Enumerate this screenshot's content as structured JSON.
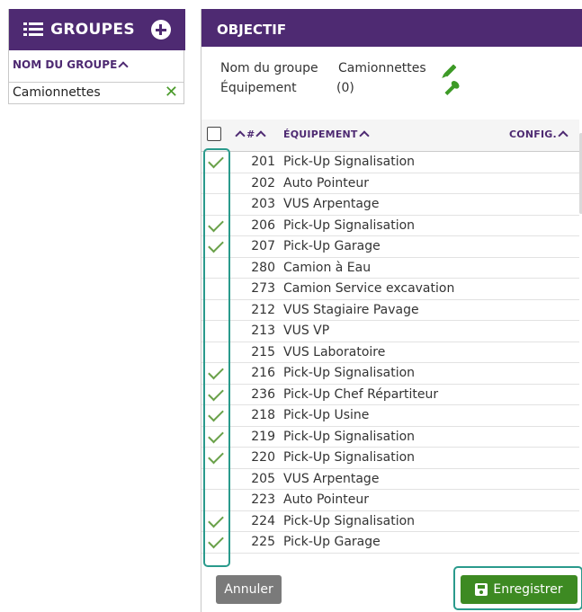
{
  "groups_panel": {
    "title": "GROUPES",
    "column_header": "NOM DU GROUPE",
    "rows": [
      {
        "name": "Camionnettes"
      }
    ]
  },
  "objective_panel": {
    "title": "OBJECTIF",
    "group_name_label": "Nom du groupe",
    "group_name_value": "Camionnettes",
    "equipment_label": "Équipement",
    "equipment_count": "(0)"
  },
  "table": {
    "col_num": "#",
    "col_equipment": "ÉQUIPEMENT",
    "col_config": "CONFIG.",
    "rows": [
      {
        "checked": true,
        "num": "201",
        "name": "Pick-Up Signalisation"
      },
      {
        "checked": false,
        "num": "202",
        "name": "Auto Pointeur"
      },
      {
        "checked": false,
        "num": "203",
        "name": "VUS Arpentage"
      },
      {
        "checked": true,
        "num": "206",
        "name": "Pick-Up Signalisation"
      },
      {
        "checked": true,
        "num": "207",
        "name": "Pick-Up Garage"
      },
      {
        "checked": false,
        "num": "280",
        "name": "Camion à Eau"
      },
      {
        "checked": false,
        "num": "273",
        "name": "Camion Service excavation"
      },
      {
        "checked": false,
        "num": "212",
        "name": "VUS Stagiaire Pavage"
      },
      {
        "checked": false,
        "num": "213",
        "name": "VUS VP"
      },
      {
        "checked": false,
        "num": "215",
        "name": "VUS Laboratoire"
      },
      {
        "checked": true,
        "num": "216",
        "name": "Pick-Up Signalisation"
      },
      {
        "checked": true,
        "num": "236",
        "name": "Pick-Up Chef Répartiteur"
      },
      {
        "checked": true,
        "num": "218",
        "name": "Pick-Up Usine"
      },
      {
        "checked": true,
        "num": "219",
        "name": "Pick-Up Signalisation"
      },
      {
        "checked": true,
        "num": "220",
        "name": "Pick-Up Signalisation"
      },
      {
        "checked": false,
        "num": "205",
        "name": "VUS Arpentage"
      },
      {
        "checked": false,
        "num": "223",
        "name": "Auto Pointeur"
      },
      {
        "checked": true,
        "num": "224",
        "name": "Pick-Up Signalisation"
      },
      {
        "checked": true,
        "num": "225",
        "name": "Pick-Up Garage"
      }
    ]
  },
  "buttons": {
    "cancel": "Annuler",
    "save": "Enregistrer"
  },
  "colors": {
    "header_purple": "#4e2a72",
    "accent_green": "#3d8a22",
    "highlight_teal": "#2a9a8c"
  }
}
